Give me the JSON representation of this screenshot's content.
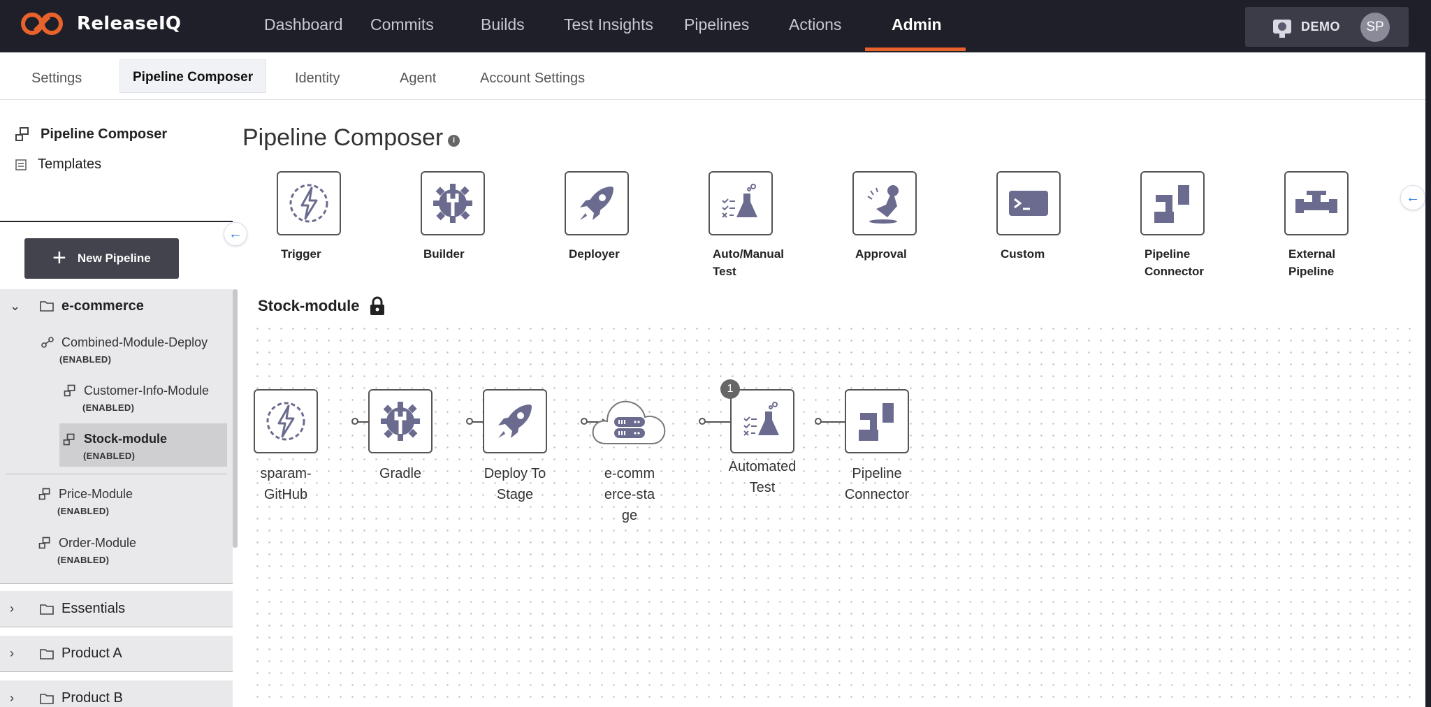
{
  "brand": {
    "name": "ReleaseIQ"
  },
  "nav": {
    "items": [
      "Dashboard",
      "Commits",
      "Builds",
      "Test Insights",
      "Pipelines",
      "Actions",
      "Admin"
    ],
    "active": "Admin"
  },
  "account": {
    "label": "DEMO",
    "initials": "SP"
  },
  "subnav": {
    "items": [
      "Settings",
      "Pipeline Composer",
      "Identity",
      "Agent",
      "Account Settings"
    ],
    "active": "Pipeline Composer"
  },
  "sidebar": {
    "links": [
      "Pipeline Composer",
      "Templates"
    ],
    "new_pipeline": "New Pipeline",
    "groups": [
      {
        "name": "e-commerce",
        "expanded": true,
        "items": [
          {
            "name": "Combined-Module-Deploy",
            "state": "(ENABLED)"
          },
          {
            "name": "Customer-Info-Module",
            "state": "(ENABLED)"
          },
          {
            "name": "Stock-module",
            "state": "(ENABLED)",
            "selected": true
          },
          {
            "name": "Price-Module",
            "state": "(ENABLED)"
          },
          {
            "name": "Order-Module",
            "state": "(ENABLED)"
          }
        ]
      },
      {
        "name": "Essentials",
        "expanded": false
      },
      {
        "name": "Product A",
        "expanded": false
      },
      {
        "name": "Product B",
        "expanded": false
      }
    ]
  },
  "main": {
    "title": "Pipeline Composer",
    "palette": [
      "Trigger",
      "Builder",
      "Deployer",
      "Auto/Manual Test",
      "Approval",
      "Custom",
      "Pipeline Connector",
      "External Pipeline"
    ],
    "pipeline_name": "Stock-module",
    "nodes": [
      {
        "label": "sparam-GitHub",
        "type": "trigger"
      },
      {
        "label": "Gradle",
        "type": "builder"
      },
      {
        "label": "Deploy To Stage",
        "type": "deployer"
      },
      {
        "label": "e-commerce-stage",
        "type": "environment"
      },
      {
        "label": "Automated Test",
        "type": "test",
        "badge": "1"
      },
      {
        "label": "Pipeline Connector",
        "type": "connector"
      }
    ]
  },
  "colors": {
    "accent": "#e8622b",
    "icon": "#6b6b8f",
    "topbar": "#1f1f2a",
    "link_blue": "#2a7de1"
  }
}
